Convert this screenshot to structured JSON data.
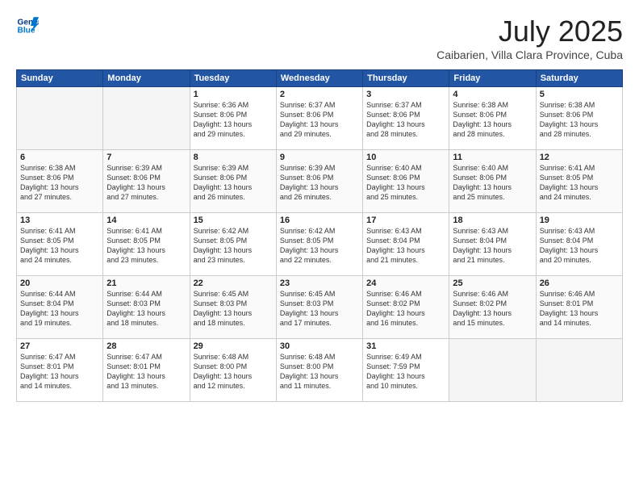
{
  "header": {
    "logo_line1": "General",
    "logo_line2": "Blue",
    "month": "July 2025",
    "location": "Caibarien, Villa Clara Province, Cuba"
  },
  "days_of_week": [
    "Sunday",
    "Monday",
    "Tuesday",
    "Wednesday",
    "Thursday",
    "Friday",
    "Saturday"
  ],
  "weeks": [
    [
      {
        "num": "",
        "info": ""
      },
      {
        "num": "",
        "info": ""
      },
      {
        "num": "1",
        "info": "Sunrise: 6:36 AM\nSunset: 8:06 PM\nDaylight: 13 hours\nand 29 minutes."
      },
      {
        "num": "2",
        "info": "Sunrise: 6:37 AM\nSunset: 8:06 PM\nDaylight: 13 hours\nand 29 minutes."
      },
      {
        "num": "3",
        "info": "Sunrise: 6:37 AM\nSunset: 8:06 PM\nDaylight: 13 hours\nand 28 minutes."
      },
      {
        "num": "4",
        "info": "Sunrise: 6:38 AM\nSunset: 8:06 PM\nDaylight: 13 hours\nand 28 minutes."
      },
      {
        "num": "5",
        "info": "Sunrise: 6:38 AM\nSunset: 8:06 PM\nDaylight: 13 hours\nand 28 minutes."
      }
    ],
    [
      {
        "num": "6",
        "info": "Sunrise: 6:38 AM\nSunset: 8:06 PM\nDaylight: 13 hours\nand 27 minutes."
      },
      {
        "num": "7",
        "info": "Sunrise: 6:39 AM\nSunset: 8:06 PM\nDaylight: 13 hours\nand 27 minutes."
      },
      {
        "num": "8",
        "info": "Sunrise: 6:39 AM\nSunset: 8:06 PM\nDaylight: 13 hours\nand 26 minutes."
      },
      {
        "num": "9",
        "info": "Sunrise: 6:39 AM\nSunset: 8:06 PM\nDaylight: 13 hours\nand 26 minutes."
      },
      {
        "num": "10",
        "info": "Sunrise: 6:40 AM\nSunset: 8:06 PM\nDaylight: 13 hours\nand 25 minutes."
      },
      {
        "num": "11",
        "info": "Sunrise: 6:40 AM\nSunset: 8:06 PM\nDaylight: 13 hours\nand 25 minutes."
      },
      {
        "num": "12",
        "info": "Sunrise: 6:41 AM\nSunset: 8:05 PM\nDaylight: 13 hours\nand 24 minutes."
      }
    ],
    [
      {
        "num": "13",
        "info": "Sunrise: 6:41 AM\nSunset: 8:05 PM\nDaylight: 13 hours\nand 24 minutes."
      },
      {
        "num": "14",
        "info": "Sunrise: 6:41 AM\nSunset: 8:05 PM\nDaylight: 13 hours\nand 23 minutes."
      },
      {
        "num": "15",
        "info": "Sunrise: 6:42 AM\nSunset: 8:05 PM\nDaylight: 13 hours\nand 23 minutes."
      },
      {
        "num": "16",
        "info": "Sunrise: 6:42 AM\nSunset: 8:05 PM\nDaylight: 13 hours\nand 22 minutes."
      },
      {
        "num": "17",
        "info": "Sunrise: 6:43 AM\nSunset: 8:04 PM\nDaylight: 13 hours\nand 21 minutes."
      },
      {
        "num": "18",
        "info": "Sunrise: 6:43 AM\nSunset: 8:04 PM\nDaylight: 13 hours\nand 21 minutes."
      },
      {
        "num": "19",
        "info": "Sunrise: 6:43 AM\nSunset: 8:04 PM\nDaylight: 13 hours\nand 20 minutes."
      }
    ],
    [
      {
        "num": "20",
        "info": "Sunrise: 6:44 AM\nSunset: 8:04 PM\nDaylight: 13 hours\nand 19 minutes."
      },
      {
        "num": "21",
        "info": "Sunrise: 6:44 AM\nSunset: 8:03 PM\nDaylight: 13 hours\nand 18 minutes."
      },
      {
        "num": "22",
        "info": "Sunrise: 6:45 AM\nSunset: 8:03 PM\nDaylight: 13 hours\nand 18 minutes."
      },
      {
        "num": "23",
        "info": "Sunrise: 6:45 AM\nSunset: 8:03 PM\nDaylight: 13 hours\nand 17 minutes."
      },
      {
        "num": "24",
        "info": "Sunrise: 6:46 AM\nSunset: 8:02 PM\nDaylight: 13 hours\nand 16 minutes."
      },
      {
        "num": "25",
        "info": "Sunrise: 6:46 AM\nSunset: 8:02 PM\nDaylight: 13 hours\nand 15 minutes."
      },
      {
        "num": "26",
        "info": "Sunrise: 6:46 AM\nSunset: 8:01 PM\nDaylight: 13 hours\nand 14 minutes."
      }
    ],
    [
      {
        "num": "27",
        "info": "Sunrise: 6:47 AM\nSunset: 8:01 PM\nDaylight: 13 hours\nand 14 minutes."
      },
      {
        "num": "28",
        "info": "Sunrise: 6:47 AM\nSunset: 8:01 PM\nDaylight: 13 hours\nand 13 minutes."
      },
      {
        "num": "29",
        "info": "Sunrise: 6:48 AM\nSunset: 8:00 PM\nDaylight: 13 hours\nand 12 minutes."
      },
      {
        "num": "30",
        "info": "Sunrise: 6:48 AM\nSunset: 8:00 PM\nDaylight: 13 hours\nand 11 minutes."
      },
      {
        "num": "31",
        "info": "Sunrise: 6:49 AM\nSunset: 7:59 PM\nDaylight: 13 hours\nand 10 minutes."
      },
      {
        "num": "",
        "info": ""
      },
      {
        "num": "",
        "info": ""
      }
    ]
  ]
}
